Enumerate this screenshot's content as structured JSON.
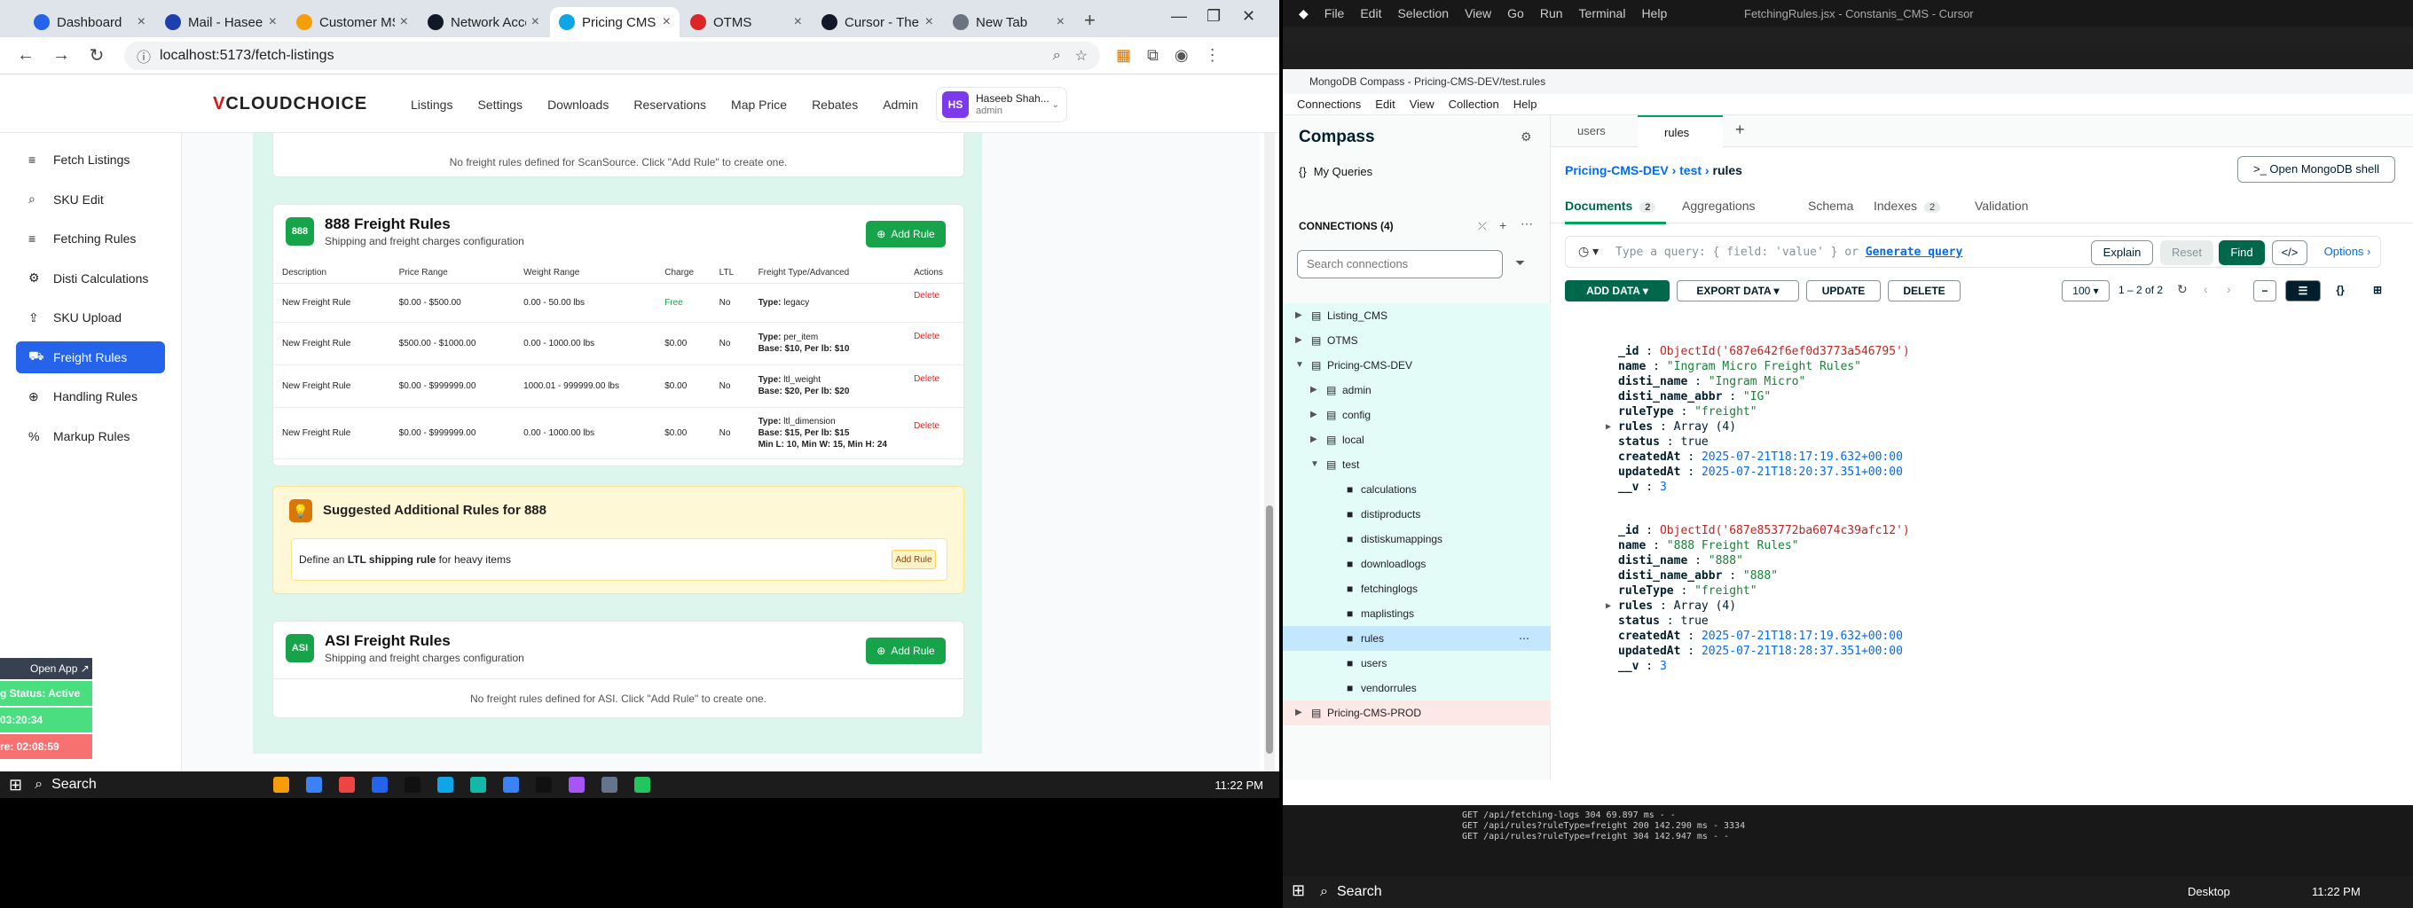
{
  "browser": {
    "tabs": [
      {
        "label": "Dashboard",
        "color": "#2563eb"
      },
      {
        "label": "Mail - Haseeb",
        "color": "#1e40af"
      },
      {
        "label": "Customer MS",
        "color": "#f59e0b"
      },
      {
        "label": "Network Access",
        "color": "#111827"
      },
      {
        "label": "Pricing CMS",
        "color": "#0ea5e9"
      },
      {
        "label": "OTMS",
        "color": "#dc2626"
      },
      {
        "label": "Cursor - The AI",
        "color": "#111827"
      },
      {
        "label": "New Tab",
        "color": "#6b7280"
      }
    ],
    "active_tab": 4,
    "url": "localhost:5173/fetch-listings"
  },
  "app": {
    "logo_prefix": "V",
    "logo_rest": "CLOUDCHOICE",
    "nav": [
      "Listings",
      "Settings",
      "Downloads",
      "Reservations",
      "Map Price",
      "Rebates",
      "Admin"
    ],
    "user_initials": "HS",
    "user_name": "Haseeb Shah...",
    "user_role": "admin",
    "sidebar": [
      {
        "label": "Fetch Listings",
        "icon": "≡"
      },
      {
        "label": "SKU Edit",
        "icon": "⌕"
      },
      {
        "label": "Fetching Rules",
        "icon": "≡"
      },
      {
        "label": "Disti Calculations",
        "icon": "⚙"
      },
      {
        "label": "SKU Upload",
        "icon": "⇪"
      },
      {
        "label": "Freight Rules",
        "icon": "⛟"
      },
      {
        "label": "Handling Rules",
        "icon": "⊕"
      },
      {
        "label": "Markup Rules",
        "icon": "%"
      }
    ],
    "active_sidebar": 5,
    "scansource_empty": "No freight rules defined for ScanSource. Click \"Add Rule\" to create one.",
    "card888": {
      "badge": "888",
      "title": "888 Freight Rules",
      "subtitle": "Shipping and freight charges configuration",
      "add_label": "Add Rule",
      "columns": [
        "Description",
        "Price Range",
        "Weight Range",
        "Charge",
        "LTL",
        "Freight Type/Advanced",
        "Actions"
      ],
      "rows": [
        {
          "desc": "New Freight Rule",
          "price": "$0.00 - $500.00",
          "weight": "0.00 - 50.00 lbs",
          "charge": "Free",
          "ltl": "No",
          "type": "legacy",
          "adv": "",
          "action": "Delete"
        },
        {
          "desc": "New Freight Rule",
          "price": "$500.00 - $1000.00",
          "weight": "0.00 - 1000.00 lbs",
          "charge": "$0.00",
          "ltl": "No",
          "type": "per_item",
          "adv": "Base: $10, Per lb: $10",
          "action": "Delete"
        },
        {
          "desc": "New Freight Rule",
          "price": "$0.00 - $999999.00",
          "weight": "1000.01 - 999999.00 lbs",
          "charge": "$0.00",
          "ltl": "No",
          "type": "ltl_weight",
          "adv": "Base: $20, Per lb: $20",
          "action": "Delete"
        },
        {
          "desc": "New Freight Rule",
          "price": "$0.00 - $999999.00",
          "weight": "0.00 - 1000.00 lbs",
          "charge": "$0.00",
          "ltl": "No",
          "type": "ltl_dimension",
          "adv": "Base: $15, Per lb: $15",
          "adv2": "Min L: 10, Min W: 15, Min H: 24",
          "action": "Delete"
        }
      ],
      "type_label": "Type:"
    },
    "suggest": {
      "title": "Suggested Additional Rules for 888",
      "text_pre": "Define an ",
      "text_bold": "LTL shipping rule",
      "text_post": " for heavy items",
      "btn": "Add Rule"
    },
    "asi": {
      "badge": "ASI",
      "title": "ASI Freight Rules",
      "subtitle": "Shipping and freight charges configuration",
      "add_label": "Add Rule",
      "empty": "No freight rules defined for ASI. Click \"Add Rule\" to create one."
    },
    "floating": {
      "open": "Open App ↗",
      "status": "g Status: Active",
      "t1": "03:20:34",
      "t2": "re: 02:08:59"
    }
  },
  "taskbar": {
    "search": "Search",
    "time": "11:22 PM",
    "colors": [
      "#f59e0b",
      "#3b82f6",
      "#ef4444",
      "#2563eb",
      "#111",
      "#0ea5e9",
      "#14b8a6",
      "#3b82f6",
      "#111",
      "#a855f7",
      "#64748b",
      "#22c55e"
    ]
  },
  "vscode": {
    "menu": [
      "File",
      "Edit",
      "Selection",
      "View",
      "Go",
      "Run",
      "Terminal",
      "Help"
    ],
    "title": "FetchingRules.jsx - Constanis_CMS - Cursor"
  },
  "compass": {
    "window_title": "MongoDB Compass - Pricing-CMS-DEV/test.rules",
    "menu": [
      "Connections",
      "Edit",
      "View",
      "Collection",
      "Help"
    ],
    "brand": "Compass",
    "my_queries": "My Queries",
    "connections_label": "CONNECTIONS (4)",
    "search_placeholder": "Search connections",
    "tree": [
      {
        "label": "Listing_CMS",
        "level": 0,
        "kind": "conn",
        "bg": "green"
      },
      {
        "label": "OTMS",
        "level": 0,
        "kind": "conn",
        "bg": "green"
      },
      {
        "label": "Pricing-CMS-DEV",
        "level": 0,
        "kind": "conn",
        "bg": "green",
        "open": true
      },
      {
        "label": "admin",
        "level": 1,
        "kind": "db",
        "bg": "green"
      },
      {
        "label": "config",
        "level": 1,
        "kind": "db",
        "bg": "green"
      },
      {
        "label": "local",
        "level": 1,
        "kind": "db",
        "bg": "green"
      },
      {
        "label": "test",
        "level": 1,
        "kind": "db",
        "bg": "green",
        "open": true
      },
      {
        "label": "calculations",
        "level": 2,
        "kind": "coll",
        "bg": "green"
      },
      {
        "label": "distiproducts",
        "level": 2,
        "kind": "coll",
        "bg": "green"
      },
      {
        "label": "distiskumappings",
        "level": 2,
        "kind": "coll",
        "bg": "green"
      },
      {
        "label": "downloadlogs",
        "level": 2,
        "kind": "coll",
        "bg": "green"
      },
      {
        "label": "fetchinglogs",
        "level": 2,
        "kind": "coll",
        "bg": "green"
      },
      {
        "label": "maplistings",
        "level": 2,
        "kind": "coll",
        "bg": "green"
      },
      {
        "label": "rules",
        "level": 2,
        "kind": "coll",
        "bg": "sel"
      },
      {
        "label": "users",
        "level": 2,
        "kind": "coll",
        "bg": "green"
      },
      {
        "label": "vendorrules",
        "level": 2,
        "kind": "coll",
        "bg": "green"
      },
      {
        "label": "Pricing-CMS-PROD",
        "level": 0,
        "kind": "conn",
        "bg": "pink"
      }
    ],
    "tabs": [
      "users",
      "rules"
    ],
    "breadcrumb": [
      "Pricing-CMS-DEV",
      "test",
      "rules"
    ],
    "open_shell": ">_ Open MongoDB shell",
    "subtabs": [
      {
        "label": "Documents",
        "count": "2"
      },
      {
        "label": "Aggregations"
      },
      {
        "label": "Schema"
      },
      {
        "label": "Indexes",
        "count": "2"
      },
      {
        "label": "Validation"
      }
    ],
    "query_placeholder": "Type a query: { field: 'value' } or ",
    "generate_query": "Generate query",
    "query_buttons": [
      "Explain",
      "Reset",
      "Find",
      "</>",
      "Options ›"
    ],
    "toolbar": [
      "ADD DATA ▾",
      "EXPORT DATA ▾",
      "UPDATE",
      "DELETE"
    ],
    "page_size": "100 ▾",
    "range": "1 – 2 of 2",
    "docs": [
      {
        "_id": "ObjectId('687e642f6ef0d3773a546795')",
        "name": "\"Ingram Micro Freight Rules\"",
        "disti_name": "\"Ingram Micro\"",
        "disti_name_abbr": "\"IG\"",
        "ruleType": "\"freight\"",
        "rules": "Array (4)",
        "status": "true",
        "createdAt": "2025-07-21T18:17:19.632+00:00",
        "updatedAt": "2025-07-21T18:20:37.351+00:00",
        "__v": "3"
      },
      {
        "_id": "ObjectId('687e853772ba6074c39afc12')",
        "name": "\"888 Freight Rules\"",
        "disti_name": "\"888\"",
        "disti_name_abbr": "\"888\"",
        "ruleType": "\"freight\"",
        "rules": "Array (4)",
        "status": "true",
        "createdAt": "2025-07-21T18:17:19.632+00:00",
        "updatedAt": "2025-07-21T18:28:37.351+00:00",
        "__v": "3"
      }
    ]
  },
  "terminal": {
    "lines": [
      "GET /api/fetching-logs 304 69.897 ms - -",
      "GET /api/rules?ruleType=freight 200 142.290 ms - 3334",
      "GET /api/rules?ruleType=freight 304 142.947 ms - -"
    ],
    "time": "11:22 PM",
    "desktop": "Desktop"
  }
}
